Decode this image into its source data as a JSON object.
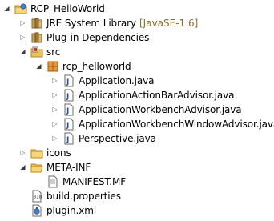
{
  "tree": {
    "project": "RCP_HelloWorld",
    "jre": {
      "label": "JRE System Library",
      "decoration": "[JavaSE-1.6]"
    },
    "plugin_deps": "Plug-in Dependencies",
    "src": "src",
    "package": "rcp_helloworld",
    "files": [
      "Application.java",
      "ApplicationActionBarAdvisor.java",
      "ApplicationWorkbenchAdvisor.java",
      "ApplicationWorkbenchWindowAdvisor.java",
      "Perspective.java"
    ],
    "icons": "icons",
    "meta_inf": "META-INF",
    "manifest": "MANIFEST.MF",
    "build_properties": "build.properties",
    "plugin_xml": "plugin.xml"
  }
}
